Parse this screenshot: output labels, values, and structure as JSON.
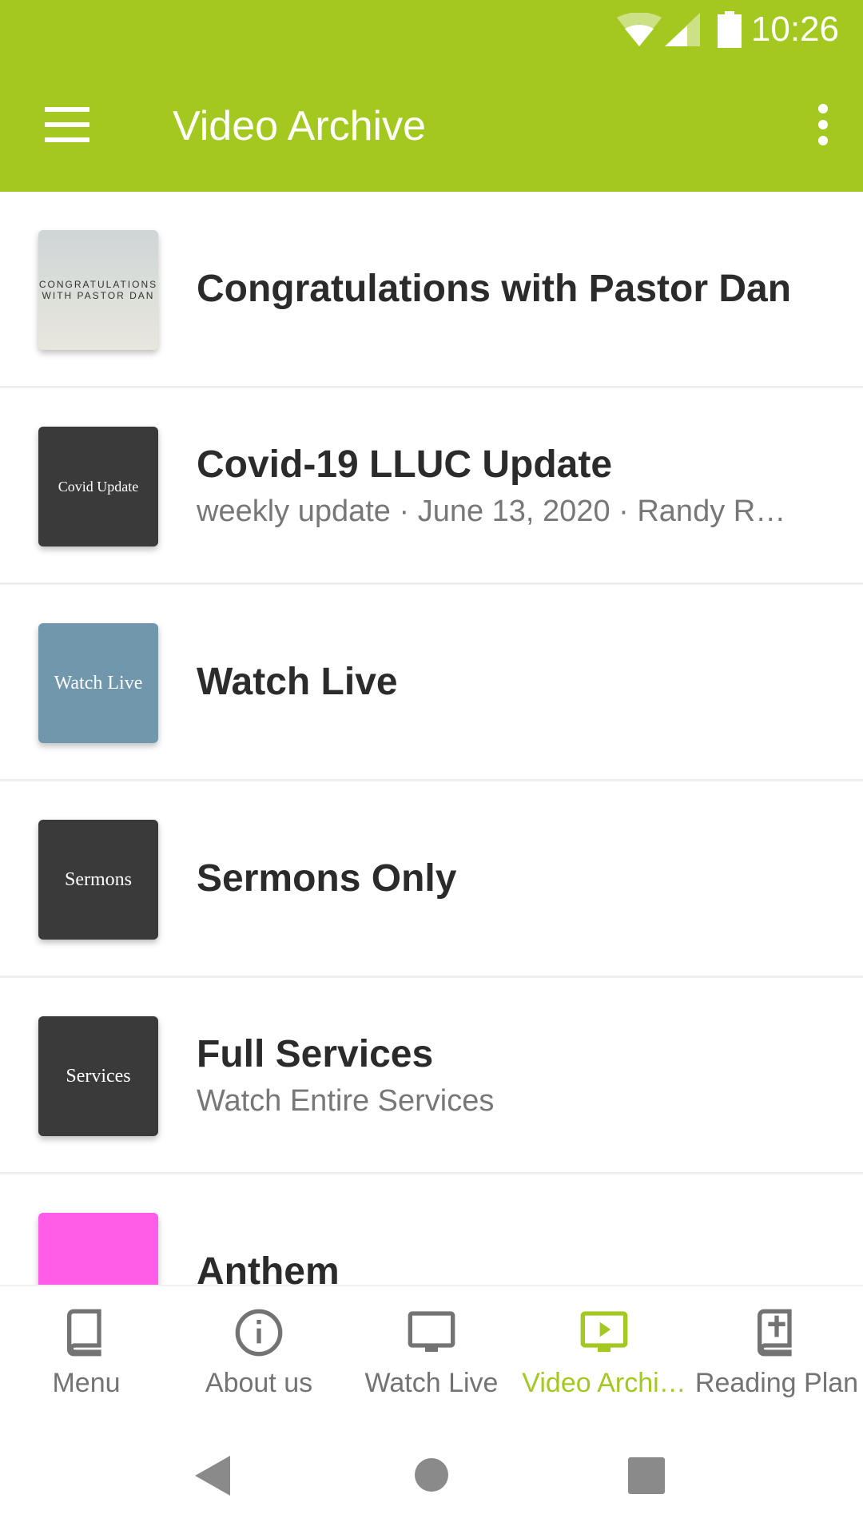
{
  "status_bar": {
    "time": "10:26"
  },
  "app_bar": {
    "title": "Video Archive"
  },
  "list": [
    {
      "title": "Congratulations with Pastor Dan",
      "subtitle": "",
      "thumb_text": "CONGRATULATIONS WITH PASTOR DAN",
      "thumb_color": "#d6dad8"
    },
    {
      "title": "Covid-19 LLUC Update",
      "subtitle": "weekly update · June 13, 2020 · Randy R…",
      "thumb_text": "Covid Update",
      "thumb_color": "#3a3a3a"
    },
    {
      "title": "Watch Live",
      "subtitle": "",
      "thumb_text": "Watch Live",
      "thumb_color": "#7197ad"
    },
    {
      "title": "Sermons Only",
      "subtitle": "",
      "thumb_text": "Sermons",
      "thumb_color": "#3a3a3a"
    },
    {
      "title": "Full Services",
      "subtitle": "Watch Entire Services",
      "thumb_text": "Services",
      "thumb_color": "#3a3a3a"
    },
    {
      "title": "Anthem",
      "subtitle": "",
      "thumb_text": "/\\",
      "thumb_color": "#ff5ce8"
    }
  ],
  "bottom_nav": [
    {
      "label": "Menu",
      "icon": "book-icon"
    },
    {
      "label": "About us",
      "icon": "info-icon"
    },
    {
      "label": "Watch Live",
      "icon": "tv-icon"
    },
    {
      "label": "Video Archi…",
      "icon": "video-play-icon",
      "active": true
    },
    {
      "label": "Reading Plan",
      "icon": "bible-icon"
    }
  ],
  "colors": {
    "accent": "#a3c921",
    "inactive": "#737373"
  }
}
